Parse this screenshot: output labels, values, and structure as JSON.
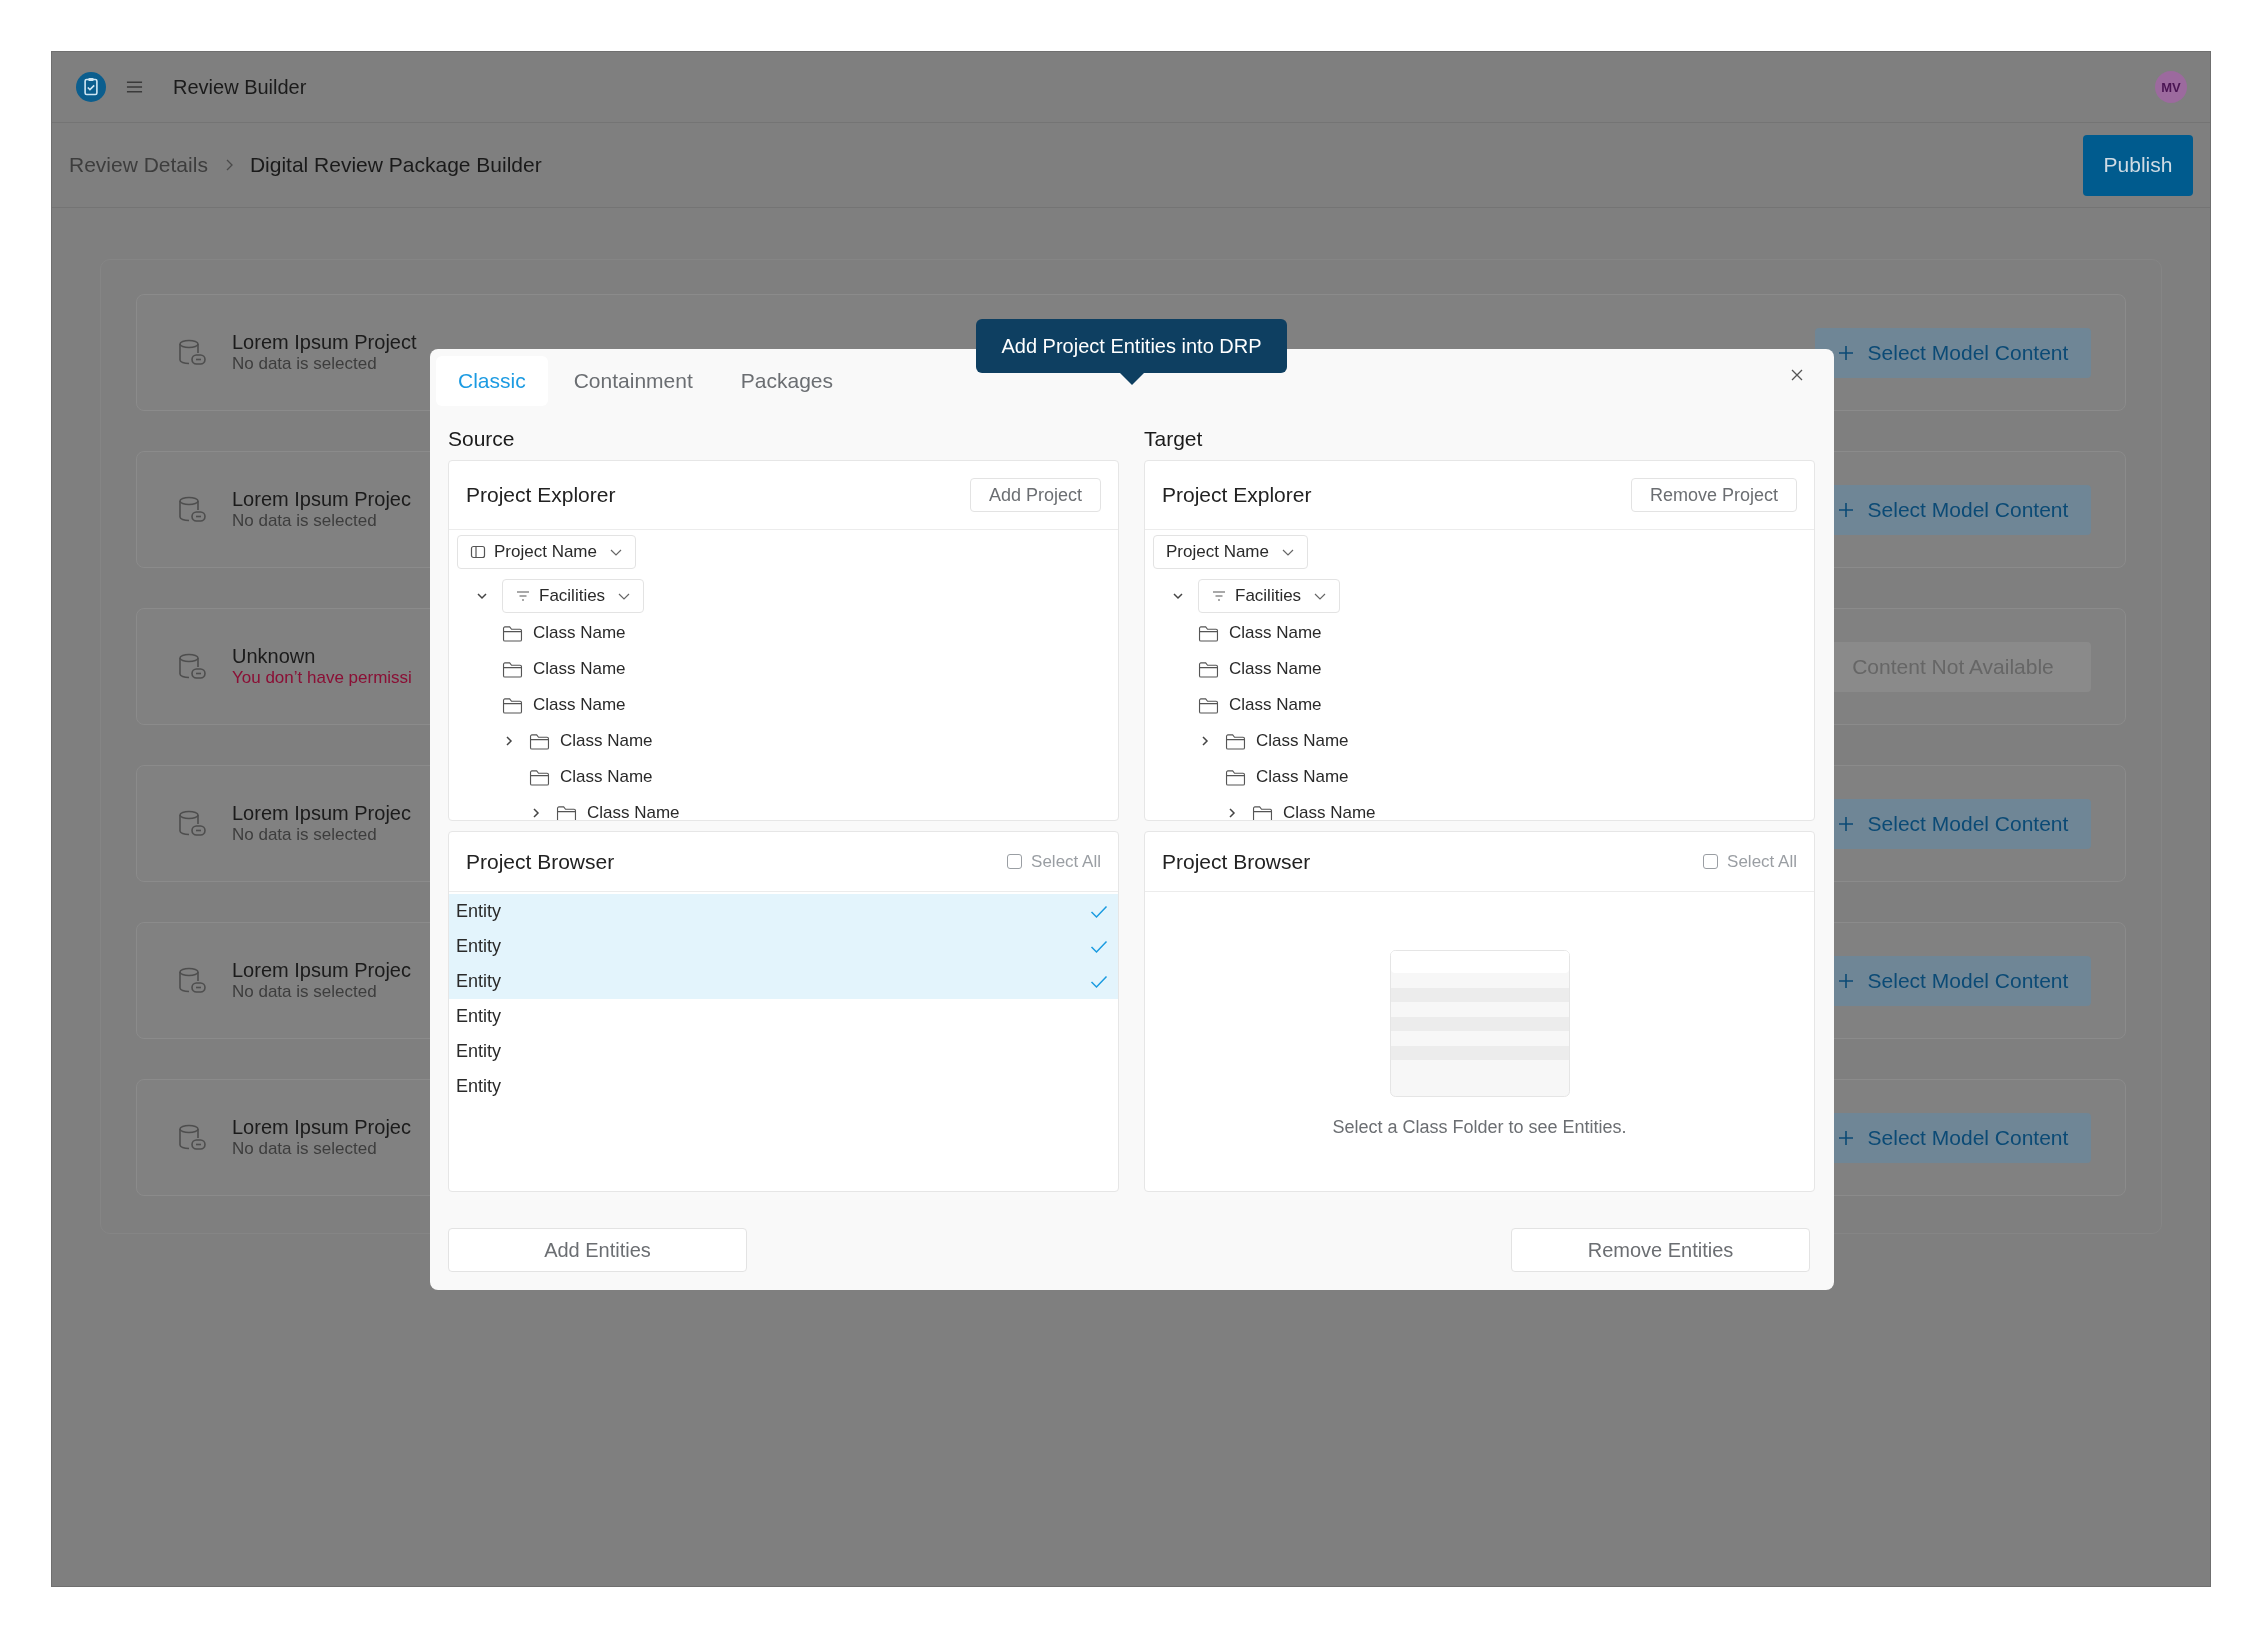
{
  "app_bar": {
    "title": "Review Builder",
    "avatar": "MV"
  },
  "breadcrumb": [
    {
      "label": "Review Details",
      "current": false
    },
    {
      "label": "Digital Review Package Builder",
      "current": true
    }
  ],
  "publish_button": "Publish",
  "projects": [
    {
      "kind": "available",
      "name": "Lorem Ipsum Project",
      "status": "No data is selected",
      "action": "Select Model Content"
    },
    {
      "kind": "available",
      "name": "Lorem Ipsum Projec",
      "status": "No data is selected",
      "action": "Select Model Content"
    },
    {
      "kind": "unavailable",
      "name": "Unknown",
      "status": "You don’t have permissi",
      "action": "Content Not Available"
    },
    {
      "kind": "available",
      "name": "Lorem Ipsum Projec",
      "status": "No data is selected",
      "action": "Select Model Content"
    },
    {
      "kind": "available",
      "name": "Lorem Ipsum Projec",
      "status": "No data is selected",
      "action": "Select Model Content"
    },
    {
      "kind": "available",
      "name": "Lorem Ipsum Projec",
      "status": "No data is selected",
      "action": "Select Model Content"
    }
  ],
  "dialog": {
    "tooltip": "Add Project Entities into DRP",
    "tabs": [
      {
        "label": "Classic",
        "selected": true
      },
      {
        "label": "Containment",
        "selected": false
      },
      {
        "label": "Packages",
        "selected": false
      }
    ],
    "panes": [
      {
        "heading": "Source",
        "explorer": {
          "title": "Project Explorer",
          "button": "Add Project",
          "project_select": {
            "label": "Project Name",
            "show_icon": true
          },
          "tree": [
            {
              "kind": "filter",
              "label": "Facilities",
              "expanded": true,
              "children": [
                {
                  "kind": "folder",
                  "label": "Class Name"
                },
                {
                  "kind": "folder",
                  "label": "Class Name"
                },
                {
                  "kind": "folder",
                  "label": "Class Name"
                },
                {
                  "kind": "folder",
                  "label": "Class Name",
                  "expanded": false,
                  "children": [
                    {
                      "kind": "folder",
                      "label": "Class Name"
                    },
                    {
                      "kind": "folder",
                      "label": "Class Name",
                      "expanded": false
                    }
                  ]
                }
              ]
            }
          ]
        },
        "browser": {
          "title": "Project Browser",
          "select_all": {
            "label": "Select All",
            "checked": false
          },
          "entities": [
            {
              "label": "Entity",
              "selected": true
            },
            {
              "label": "Entity",
              "selected": true
            },
            {
              "label": "Entity",
              "selected": true
            },
            {
              "label": "Entity",
              "selected": false
            },
            {
              "label": "Entity",
              "selected": false
            },
            {
              "label": "Entity",
              "selected": false
            }
          ]
        },
        "action": "Add Entities"
      },
      {
        "heading": "Target",
        "explorer": {
          "title": "Project Explorer",
          "button": "Remove Project",
          "project_select": {
            "label": "Project Name",
            "show_icon": false
          },
          "tree": [
            {
              "kind": "filter",
              "label": "Facilities",
              "expanded": true,
              "children": [
                {
                  "kind": "folder",
                  "label": "Class Name"
                },
                {
                  "kind": "folder",
                  "label": "Class Name"
                },
                {
                  "kind": "folder",
                  "label": "Class Name"
                },
                {
                  "kind": "folder",
                  "label": "Class Name",
                  "expanded": false,
                  "children": [
                    {
                      "kind": "folder",
                      "label": "Class Name"
                    },
                    {
                      "kind": "folder",
                      "label": "Class Name",
                      "expanded": false
                    }
                  ]
                }
              ]
            }
          ]
        },
        "browser": {
          "title": "Project Browser",
          "select_all": {
            "label": "Select All",
            "checked": false
          },
          "empty_text": "Select a Class Folder to see Entities."
        },
        "action": "Remove Entities"
      }
    ]
  }
}
